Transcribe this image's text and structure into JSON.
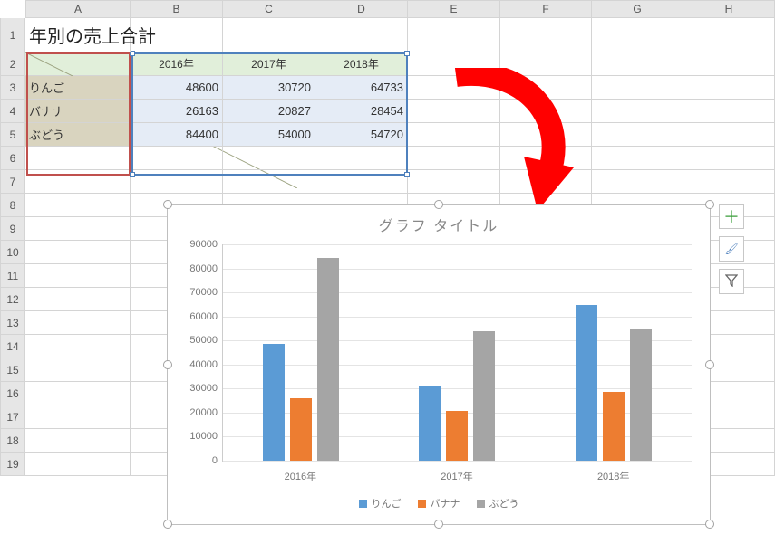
{
  "columns": [
    "A",
    "B",
    "C",
    "D",
    "E",
    "F",
    "G",
    "H"
  ],
  "row_numbers": [
    "1",
    "2",
    "3",
    "4",
    "5",
    "6",
    "7",
    "8",
    "9",
    "10",
    "11",
    "12",
    "13",
    "14",
    "15",
    "16",
    "17",
    "18",
    "19"
  ],
  "title_cell": "年別の売上合計",
  "table": {
    "col_headers": [
      "2016年",
      "2017年",
      "2018年"
    ],
    "row_headers": [
      "りんご",
      "バナナ",
      "ぶどう"
    ],
    "values": [
      [
        48600,
        30720,
        64733
      ],
      [
        26163,
        20827,
        28454
      ],
      [
        84400,
        54000,
        54720
      ]
    ]
  },
  "chart_data": {
    "type": "bar",
    "title": "グラフ タイトル",
    "categories": [
      "2016年",
      "2017年",
      "2018年"
    ],
    "series": [
      {
        "name": "りんご",
        "values": [
          48600,
          30720,
          64733
        ],
        "color": "#5b9bd5"
      },
      {
        "name": "バナナ",
        "values": [
          26163,
          20827,
          28454
        ],
        "color": "#ed7d31"
      },
      {
        "name": "ぶどう",
        "values": [
          84400,
          54000,
          54720
        ],
        "color": "#a5a5a5"
      }
    ],
    "ylim": [
      0,
      90000
    ],
    "yticks": [
      0,
      10000,
      20000,
      30000,
      40000,
      50000,
      60000,
      70000,
      80000,
      90000
    ],
    "xlabel": "",
    "ylabel": ""
  },
  "side_buttons": {
    "add": "＋",
    "brush": "🖌",
    "filter": "▽"
  }
}
